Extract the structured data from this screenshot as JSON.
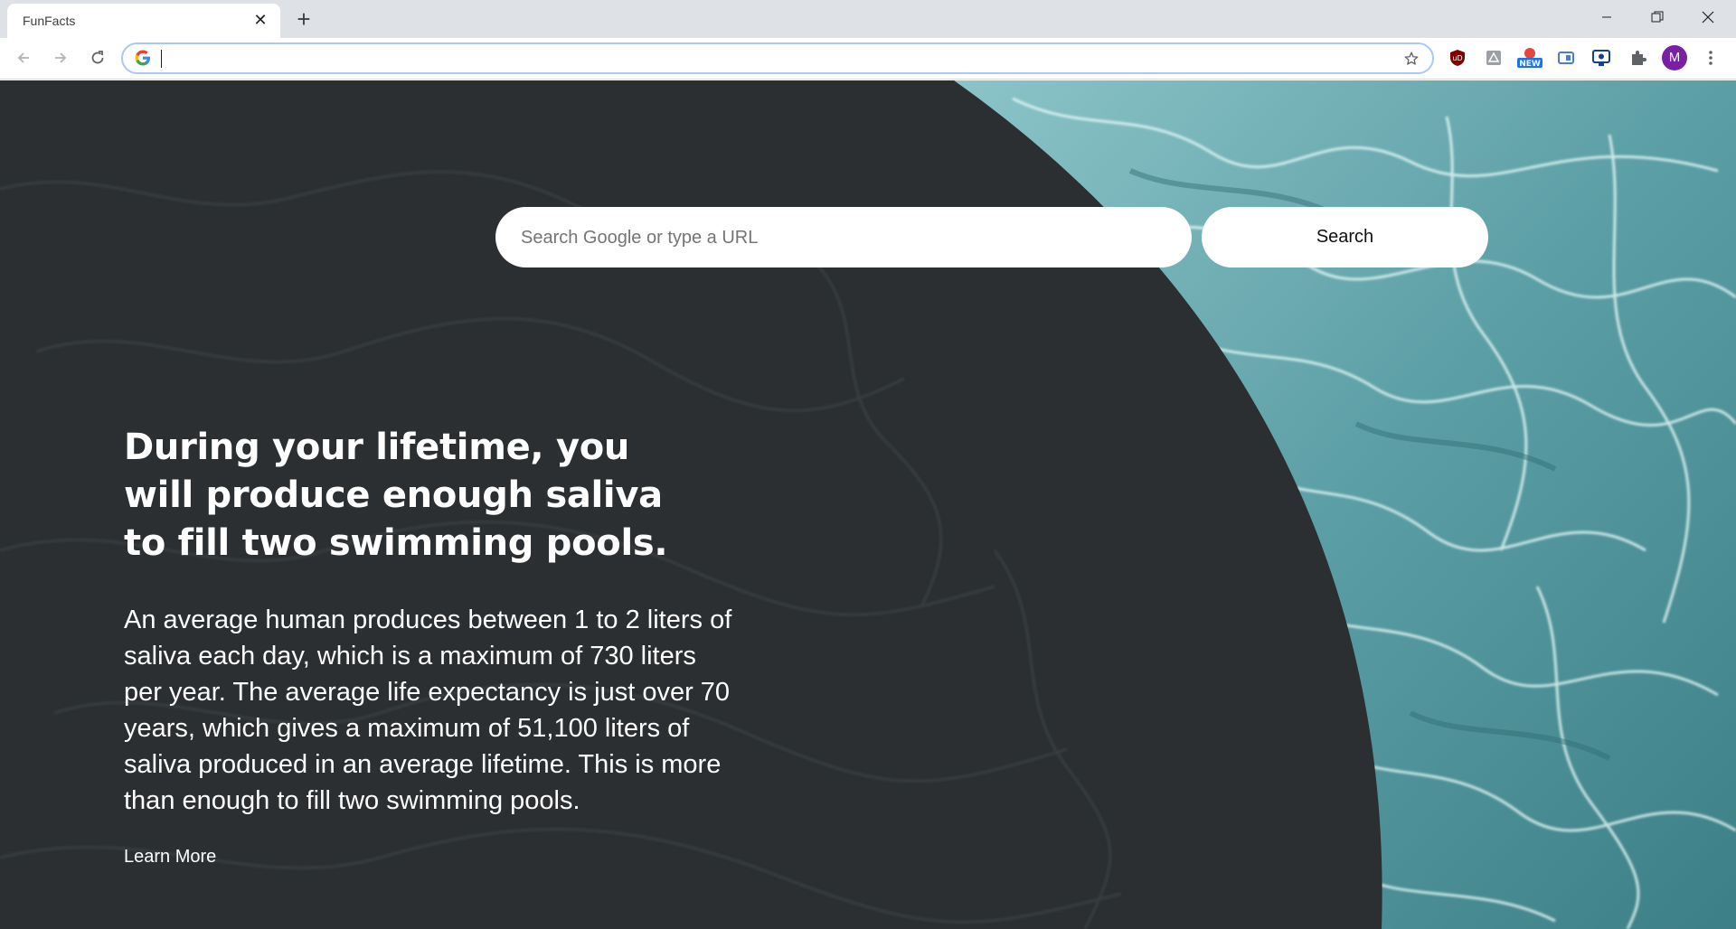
{
  "browser": {
    "tab_title": "FunFacts",
    "tab_close_icon": "close-icon",
    "new_tab_icon": "plus-icon",
    "window_controls": [
      "minimize-icon",
      "restore-icon",
      "close-icon"
    ],
    "omnibox": {
      "value": "",
      "placeholder": ""
    },
    "extensions": [
      "ublock-icon",
      "pdf-icon",
      "new-badge-extension-icon",
      "translate-icon",
      "screen-recorder-icon",
      "puzzle-icon"
    ],
    "profile_initial": "M",
    "profile_color": "#7b1fa2"
  },
  "page": {
    "search": {
      "placeholder": "Search Google or type a URL",
      "button_label": "Search"
    },
    "fact": {
      "title": "During your lifetime, you will produce enough saliva to fill two swimming pools.",
      "body": "An average human produces between 1 to 2 liters of saliva each day, which is a maximum of 730 liters per year. The average life expectancy is just over 70 years, which gives a maximum of 51,100 liters of saliva produced in an average lifetime. This is more than enough to fill two swimming pools.",
      "learn_more": "Learn More"
    },
    "colors": {
      "dark_bg": "#2b2f31",
      "water": "#5a9fa6"
    }
  }
}
